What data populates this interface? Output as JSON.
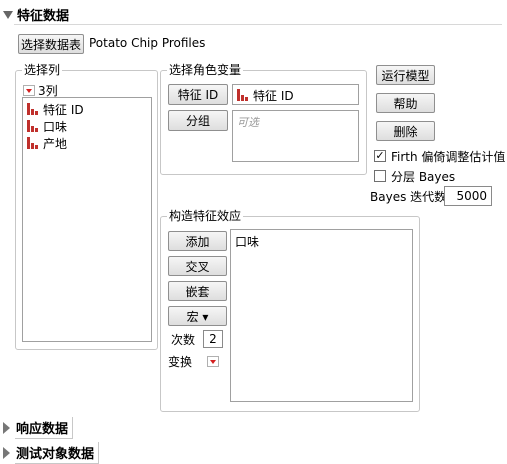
{
  "header": {
    "title": "特征数据"
  },
  "select_table": {
    "button_label": "选择数据表",
    "table_name": "Potato Chip Profiles"
  },
  "select_columns": {
    "label": "选择列",
    "count_label": "3列",
    "items": [
      {
        "label": "特征 ID",
        "icon": "nominal-bar-icon"
      },
      {
        "label": "口味",
        "icon": "nominal-bar-icon"
      },
      {
        "label": "产地",
        "icon": "nominal-bar-icon"
      }
    ]
  },
  "roles": {
    "label": "选择角色变量",
    "feature_id_button": "特征 ID",
    "feature_id_value": "特征 ID",
    "group_button": "分组",
    "group_placeholder": "可选"
  },
  "actions": {
    "run_model": "运行模型",
    "help": "帮助",
    "remove": "删除"
  },
  "options": {
    "firth_label": "Firth 偏倚调整估计值",
    "firth_checked": true,
    "bayes_label": "分层 Bayes",
    "bayes_checked": false,
    "bayes_iterations_label": "Bayes 迭代数",
    "bayes_iterations_value": "5000"
  },
  "effects": {
    "label": "构造特征效应",
    "add": "添加",
    "cross": "交叉",
    "nest": "嵌套",
    "macro": "宏 ▾",
    "degree_label": "次数",
    "degree_value": "2",
    "transform_label": "变换",
    "items": [
      "口味"
    ]
  },
  "collapsed_sections": [
    {
      "title": "响应数据"
    },
    {
      "title": "测试对象数据"
    }
  ],
  "colors": {
    "nominal_icon": "#c0302c",
    "dropdown_arrow": "#d42020"
  }
}
